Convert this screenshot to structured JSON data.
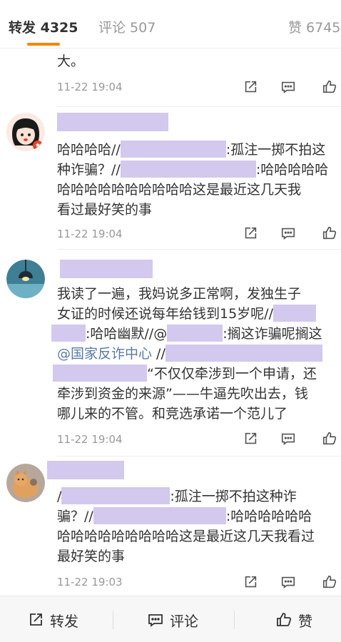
{
  "tabs": {
    "repost": "转发 4325",
    "comments": "评论 507",
    "likes": "赞 6745"
  },
  "comments": [
    {
      "lines": [
        "大。"
      ],
      "time": "11-22 19:04"
    },
    {
      "line1_a": "哈哈哈哈//",
      "line1_b": ":孤注一掷不拍这",
      "line2_a": "种诈骗？//",
      "line2_b": ":哈哈哈哈哈",
      "line3": "哈哈哈哈哈哈哈哈哈哈这是最近这几天我",
      "line4": "看过最好笑的事",
      "time": "11-22 19:04"
    },
    {
      "line1": "我读了一遍，我妈说多正常啊，发独生子",
      "line2": "女证的时候还说每年给钱到15岁呢//",
      "line3_a": ":哈哈幽默//@",
      "line3_b": ":搁这诈骗呢搁这",
      "line4_link": "@国家反诈中心",
      "line4_b": " //",
      "line5": "“不仅仅牵涉到一个申请，还",
      "line6": "牵涉到资金的来源”——牛逼先吹出去，钱",
      "line7": "哪儿来的不管。和竞选承诺一个范儿了",
      "time": "11-22 19:04"
    },
    {
      "line1_a": "/",
      "line1_b": ":孤注一掷不拍这种诈",
      "line2_a": "骗？//",
      "line2_b": ":哈哈哈哈哈哈",
      "line3": "哈哈哈哈哈哈哈哈哈这是最近这几天我看过",
      "line4": "最好笑的事",
      "time": "11-22 19:03"
    }
  ],
  "footer": {
    "repost": "转发",
    "comment": "评论",
    "like": "赞"
  }
}
